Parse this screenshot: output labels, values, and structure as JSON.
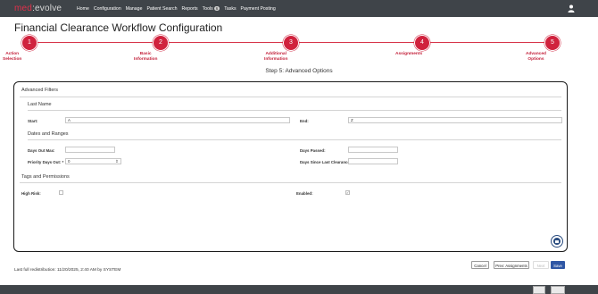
{
  "app": {
    "brand_part1": "med",
    "brand_part2": "evolve",
    "nav": [
      "Home",
      "Configuration",
      "Manage",
      "Patient Search",
      "Reports",
      "Tools",
      "Tasks",
      "Payment Posting"
    ],
    "tools_badge": "6"
  },
  "page": {
    "title": "Financial Clearance Workflow Configuration"
  },
  "stepper": {
    "steps": [
      {
        "num": "1",
        "label": "Action\nSelection"
      },
      {
        "num": "2",
        "label": "Basic\nInformation"
      },
      {
        "num": "3",
        "label": "Additional\nInformation"
      },
      {
        "num": "4",
        "label": "Assignments"
      },
      {
        "num": "5",
        "label": "Advanced\nOptions"
      }
    ],
    "current_heading": "Step 5: Advanced Options"
  },
  "advanced": {
    "title": "Advanced Filters",
    "last_name": {
      "title": "Last Name",
      "start_label": "Start:",
      "start_value": "A",
      "end_label": "End:",
      "end_value": "Z"
    },
    "dates": {
      "title": "Dates and Ranges",
      "days_out_max_label": "Days Out Max:",
      "days_out_max_value": "",
      "priority_days_label": "Priority Days Out: *",
      "priority_days_value": "0",
      "days_passed_label": "Days Passed:",
      "days_passed_value": "",
      "days_since_label": "Days Since Last Clearance:",
      "days_since_value": ""
    },
    "tags": {
      "title": "Tags and Permissions",
      "high_risk_label": "High Risk:",
      "high_risk_checked": false,
      "enabled_label": "Enabled:",
      "enabled_checked": true
    }
  },
  "footer": {
    "note": "Last full redistribution: 11/20/2025, 2:40 AM by SYSTEM",
    "cancel": "Cancel",
    "prev": "Prev: Assignments",
    "next": "Next",
    "save": "Save"
  },
  "colors": {
    "accent": "#d0223d",
    "nav_bg": "#3f4449",
    "primary_button": "#2f57a5"
  }
}
